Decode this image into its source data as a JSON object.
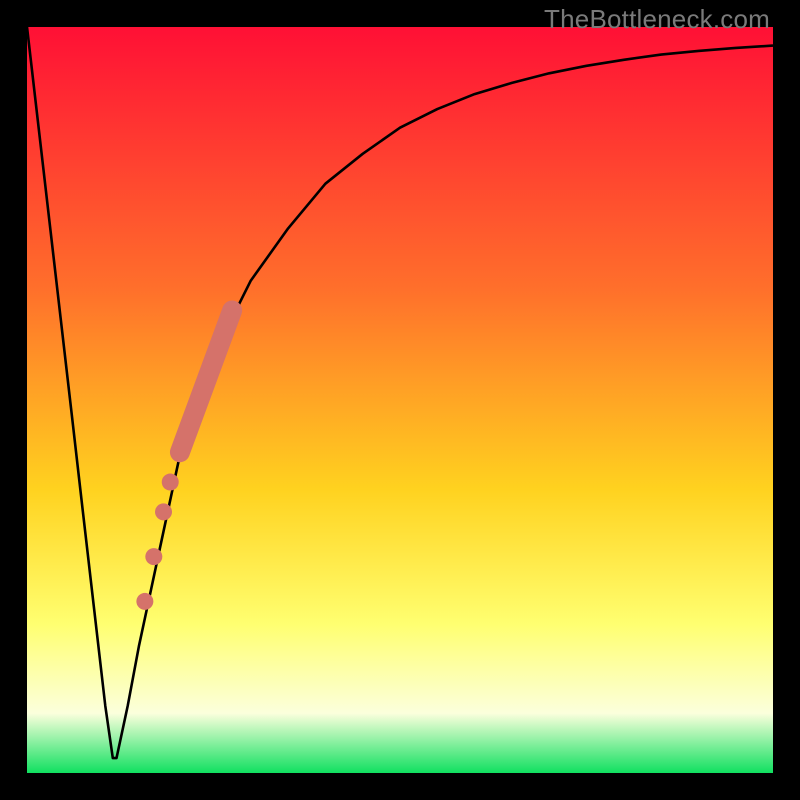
{
  "watermark": "TheBottleneck.com",
  "colors": {
    "frame": "#000000",
    "curve": "#000000",
    "markers": "#d5726a",
    "gradient_top": "#ff1035",
    "gradient_mid1": "#ff6f2b",
    "gradient_mid2": "#ffd21f",
    "gradient_mid3": "#ffff70",
    "gradient_mid4": "#fbffdc",
    "gradient_bottom": "#10e060"
  },
  "chart_data": {
    "type": "line",
    "title": "",
    "xlabel": "",
    "ylabel": "",
    "xlim": [
      0,
      100
    ],
    "ylim": [
      0,
      100
    ],
    "grid": false,
    "legend": false,
    "series": [
      {
        "name": "bottleneck-curve",
        "x": [
          0.0,
          1.5,
          3.0,
          4.5,
          6.0,
          7.5,
          9.0,
          10.5,
          11.5,
          12.0,
          13.5,
          15.0,
          16.5,
          18.0,
          19.5,
          21.0,
          25.0,
          30.0,
          35.0,
          40.0,
          45.0,
          50.0,
          55.0,
          60.0,
          65.0,
          70.0,
          75.0,
          80.0,
          85.0,
          90.0,
          95.0,
          100.0
        ],
        "y": [
          100.0,
          87.0,
          74.0,
          61.0,
          48.0,
          35.0,
          22.0,
          9.0,
          2.0,
          2.0,
          9.0,
          17.0,
          24.0,
          31.0,
          38.0,
          45.0,
          56.0,
          66.0,
          73.0,
          79.0,
          83.0,
          86.5,
          89.0,
          91.0,
          92.5,
          93.8,
          94.8,
          95.6,
          96.3,
          96.8,
          97.2,
          97.5
        ]
      }
    ],
    "markers": [
      {
        "name": "marker-band",
        "shape": "thick-segment",
        "x_range": [
          20.5,
          27.5
        ],
        "y_range": [
          43,
          62
        ]
      },
      {
        "name": "marker-dot-1",
        "shape": "dot",
        "x": 19.2,
        "y": 39
      },
      {
        "name": "marker-dot-2",
        "shape": "dot",
        "x": 18.3,
        "y": 35
      },
      {
        "name": "marker-dot-3",
        "shape": "dot",
        "x": 17.0,
        "y": 29
      },
      {
        "name": "marker-dot-4",
        "shape": "dot",
        "x": 15.8,
        "y": 23
      }
    ]
  }
}
